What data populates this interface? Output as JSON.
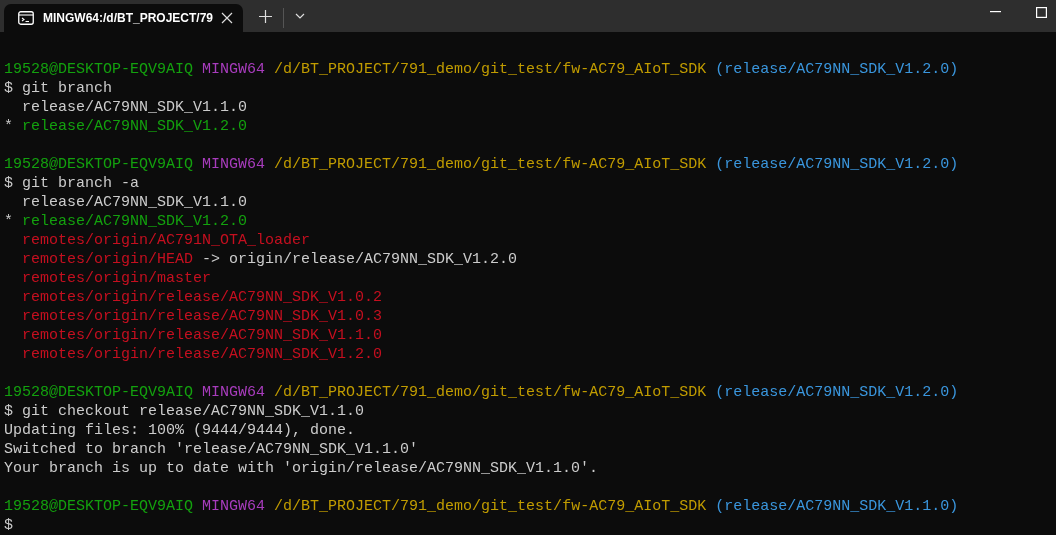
{
  "window": {
    "tab_title": "MINGW64:/d/BT_PROJECT/79"
  },
  "sessions": [
    {
      "prompt": {
        "user": "19528@DESKTOP-EQV9AIQ",
        "shell": "MINGW64",
        "path": "/d/BT_PROJECT/791_demo/git_test/fw-AC79_AIoT_SDK",
        "branch": "(release/AC79NN_SDK_V1.2.0)"
      },
      "command": "git branch",
      "output": [
        [
          {
            "text": "  release/AC79NN_SDK_V1.1.0",
            "kind": "plain"
          }
        ],
        [
          {
            "text": "* ",
            "kind": "plain"
          },
          {
            "text": "release/AC79NN_SDK_V1.2.0",
            "kind": "current"
          }
        ]
      ]
    },
    {
      "prompt": {
        "user": "19528@DESKTOP-EQV9AIQ",
        "shell": "MINGW64",
        "path": "/d/BT_PROJECT/791_demo/git_test/fw-AC79_AIoT_SDK",
        "branch": "(release/AC79NN_SDK_V1.2.0)"
      },
      "command": "git branch -a",
      "output": [
        [
          {
            "text": "  release/AC79NN_SDK_V1.1.0",
            "kind": "plain"
          }
        ],
        [
          {
            "text": "* ",
            "kind": "plain"
          },
          {
            "text": "release/AC79NN_SDK_V1.2.0",
            "kind": "current"
          }
        ],
        [
          {
            "text": "  remotes/origin/AC791N_OTA_loader",
            "kind": "remote"
          }
        ],
        [
          {
            "text": "  remotes/origin/HEAD",
            "kind": "remote"
          },
          {
            "text": " -> origin/release/AC79NN_SDK_V1.2.0",
            "kind": "plain"
          }
        ],
        [
          {
            "text": "  remotes/origin/master",
            "kind": "remote"
          }
        ],
        [
          {
            "text": "  remotes/origin/release/AC79NN_SDK_V1.0.2",
            "kind": "remote"
          }
        ],
        [
          {
            "text": "  remotes/origin/release/AC79NN_SDK_V1.0.3",
            "kind": "remote"
          }
        ],
        [
          {
            "text": "  remotes/origin/release/AC79NN_SDK_V1.1.0",
            "kind": "remote"
          }
        ],
        [
          {
            "text": "  remotes/origin/release/AC79NN_SDK_V1.2.0",
            "kind": "remote"
          }
        ]
      ]
    },
    {
      "prompt": {
        "user": "19528@DESKTOP-EQV9AIQ",
        "shell": "MINGW64",
        "path": "/d/BT_PROJECT/791_demo/git_test/fw-AC79_AIoT_SDK",
        "branch": "(release/AC79NN_SDK_V1.2.0)"
      },
      "command": "git checkout release/AC79NN_SDK_V1.1.0",
      "output": [
        [
          {
            "text": "Updating files: 100% (9444/9444), done.",
            "kind": "plain"
          }
        ],
        [
          {
            "text": "Switched to branch 'release/AC79NN_SDK_V1.1.0'",
            "kind": "plain"
          }
        ],
        [
          {
            "text": "Your branch is up to date with 'origin/release/AC79NN_SDK_V1.1.0'.",
            "kind": "plain"
          }
        ]
      ]
    },
    {
      "prompt": {
        "user": "19528@DESKTOP-EQV9AIQ",
        "shell": "MINGW64",
        "path": "/d/BT_PROJECT/791_demo/git_test/fw-AC79_AIoT_SDK",
        "branch": "(release/AC79NN_SDK_V1.1.0)"
      }
    }
  ],
  "prompt_symbol": "$"
}
